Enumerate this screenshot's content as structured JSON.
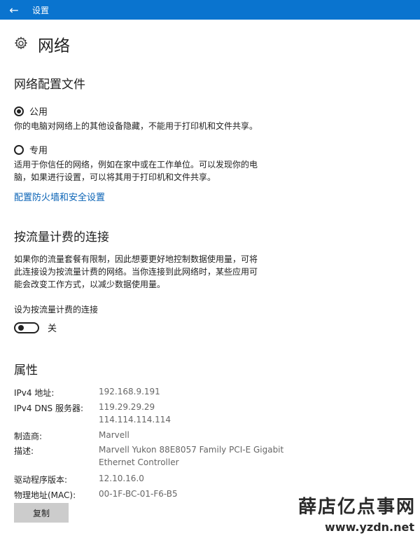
{
  "titlebar": {
    "back_icon": "arrow-left-icon",
    "title": "设置",
    "color": "#0a74cf"
  },
  "header": {
    "icon": "gear-icon",
    "title": "网络"
  },
  "profile": {
    "heading": "网络配置文件",
    "options": [
      {
        "label": "公用",
        "checked": true,
        "description": "你的电脑对网络上的其他设备隐藏，不能用于打印机和文件共享。"
      },
      {
        "label": "专用",
        "checked": false,
        "description_lines": [
          "适用于你信任的网络，例如在家中或在工作单位。可以发现你的电",
          "脑，如果进行设置，可以将其用于打印机和文件共享。"
        ]
      }
    ],
    "firewall_link": "配置防火墙和安全设置"
  },
  "metered": {
    "heading": "按流量计费的连接",
    "description_lines": [
      "如果你的流量套餐有限制，因此想要更好地控制数据使用量，可将",
      "此连接设为按流量计费的网络。当你连接到此网络时，某些应用可",
      "能会改变工作方式，以减少数据使用量。"
    ],
    "toggle_label": "设为按流量计费的连接",
    "toggle_state": "关",
    "toggle_on": false
  },
  "properties": {
    "heading": "属性",
    "ipv4_label": "IPv4 地址:",
    "ipv4_value": "192.168.9.191",
    "dns_label": "IPv4 DNS 服务器:",
    "dns_value_1": "119.29.29.29",
    "dns_value_2": "114.114.114.114",
    "manufacturer_label": "制造商:",
    "manufacturer_value": "Marvell",
    "description_label": "描述:",
    "description_value_1": "Marvell Yukon 88E8057 Family PCI-E Gigabit",
    "description_value_2": "Ethernet Controller",
    "driver_label": "驱动程序版本:",
    "driver_value": "12.10.16.0",
    "mac_label": "物理地址(MAC):",
    "mac_value": "00-1F-BC-01-F6-B5",
    "copy_button": "复制"
  },
  "watermark": {
    "text": "薛店亿点事网",
    "url": "www.yzdn.net"
  }
}
